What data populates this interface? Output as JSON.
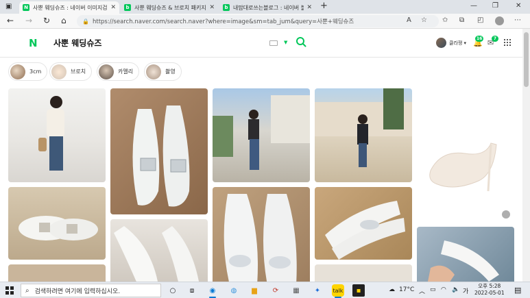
{
  "browser": {
    "tabs": [
      {
        "favicon": "N",
        "title": "사뿐 웨딩슈즈 : 네이버 이미지검",
        "active": true
      },
      {
        "favicon": "blog",
        "title": "사뿐 웨딩슈즈 & 브로치 패키지",
        "active": false
      },
      {
        "favicon": "blog",
        "title": "내맘대로쓰는블로그 : 네이버 블",
        "active": false
      }
    ],
    "new_tab": "+",
    "url": "https://search.naver.com/search.naver?where=image&sm=tab_jum&query=사뿐+웨딩슈즈",
    "window_controls": [
      "—",
      "❐",
      "✕"
    ]
  },
  "naver": {
    "logo": "N",
    "query": "사뿐 웨딩슈즈",
    "user_name": "클라쟁",
    "notification_count": "16",
    "mail_count": "7"
  },
  "chips": [
    {
      "label": "3cm",
      "color": "#b89a7e"
    },
    {
      "label": "브로치",
      "color": "#d8cfc5"
    },
    {
      "label": "카멜리",
      "color": "#8a8078"
    },
    {
      "label": "촬영",
      "color": "#c9b7a8"
    }
  ],
  "taskbar": {
    "search_placeholder": "검색하려면 여기에 입력하십시오.",
    "weather": "17°C",
    "time": "오후 5:28",
    "date": "2022-05-01",
    "ime": "가"
  }
}
